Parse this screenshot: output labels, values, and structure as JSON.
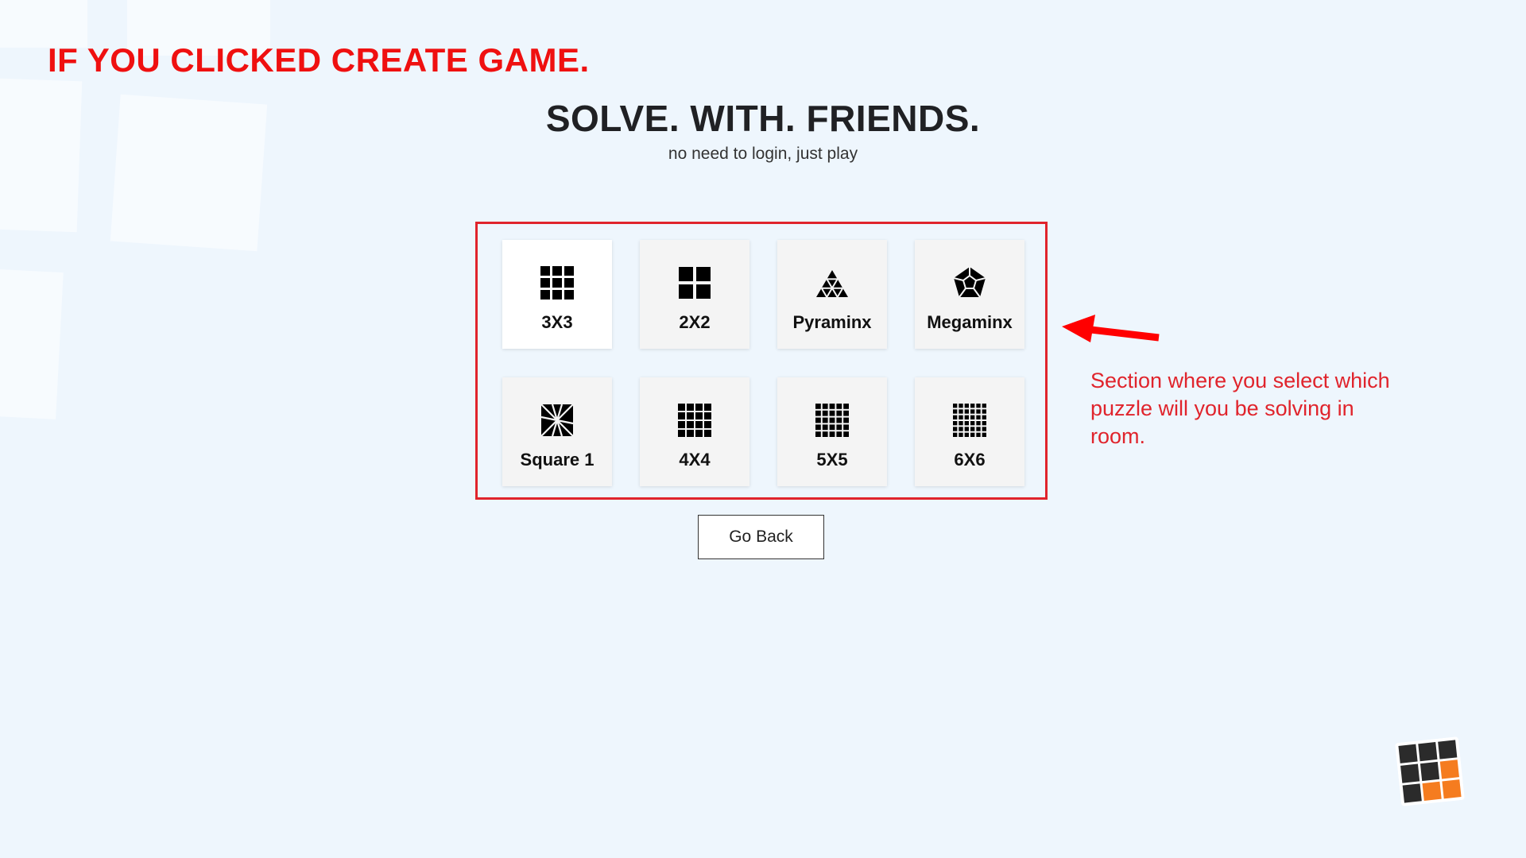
{
  "annotation": {
    "heading": "IF YOU CLICKED CREATE GAME.",
    "note": "Section where you select which puzzle will you be solving in room.",
    "color": "#e0242c"
  },
  "header": {
    "title": "SOLVE. WITH. FRIENDS.",
    "subtitle": "no need to login, just play"
  },
  "puzzles": [
    {
      "label": "3X3",
      "icon": "cube-3x3-icon",
      "selected": true
    },
    {
      "label": "2X2",
      "icon": "cube-2x2-icon",
      "selected": false
    },
    {
      "label": "Pyraminx",
      "icon": "pyraminx-icon",
      "selected": false
    },
    {
      "label": "Megaminx",
      "icon": "megaminx-icon",
      "selected": false
    },
    {
      "label": "Square 1",
      "icon": "square-1-icon",
      "selected": false
    },
    {
      "label": "4X4",
      "icon": "cube-4x4-icon",
      "selected": false
    },
    {
      "label": "5X5",
      "icon": "cube-5x5-icon",
      "selected": false
    },
    {
      "label": "6X6",
      "icon": "cube-6x6-icon",
      "selected": false
    }
  ],
  "actions": {
    "go_back_label": "Go Back"
  },
  "brand": {
    "logo": "cube-logo-icon",
    "accent": "#f57c1f",
    "dark": "#2b2b2b"
  }
}
